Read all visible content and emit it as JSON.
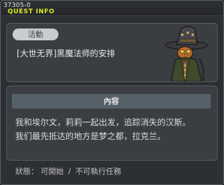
{
  "window": {
    "quest_id": "37305-0",
    "title": "QUEST INFO"
  },
  "quest": {
    "category_tag": "活動",
    "name": "[大世无界]黑魔法师的安排",
    "npc_icon": "witch-npc-illustration"
  },
  "content": {
    "heading": "內容",
    "lines": [
      "我和埃尔文，莉莉一起出发，追踪消失的汉斯。",
      "我们最先抵达的地方是梦之都，拉克兰。"
    ]
  },
  "status": {
    "label": "狀態：",
    "value1": "可開始",
    "separator": "/",
    "value2": "不可執行任務"
  },
  "colors": {
    "title_accent": "#dde826",
    "panel_bg": "#3a3e43",
    "window_bg": "#2c2f33"
  }
}
